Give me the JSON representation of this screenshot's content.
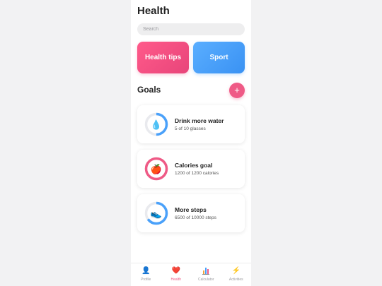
{
  "page": {
    "title": "Health"
  },
  "search": {
    "placeholder": "Search"
  },
  "tiles": [
    {
      "label": "Health tips",
      "color": "#ef5a86"
    },
    {
      "label": "Sport",
      "color": "#4aa1fa"
    }
  ],
  "goals": {
    "heading": "Goals",
    "add_label": "+",
    "items": [
      {
        "title": "Drink more water",
        "subtitle": "5 of 10 glasses",
        "icon": "water-drop-icon",
        "progress": 0.5,
        "color": "#4aa1fa"
      },
      {
        "title": "Calories goal",
        "subtitle": "1200 of 1200 calories",
        "icon": "apple-icon",
        "progress": 1.0,
        "color": "#ef5a86"
      },
      {
        "title": "More steps",
        "subtitle": "6500 of 10000 steps",
        "icon": "sneaker-icon",
        "progress": 0.65,
        "color": "#4aa1fa"
      }
    ]
  },
  "tabbar": {
    "active": "Health",
    "tabs": [
      {
        "label": "Profile",
        "icon": "user-icon"
      },
      {
        "label": "Health",
        "icon": "heart-icon"
      },
      {
        "label": "Calculator",
        "icon": "chart-icon"
      },
      {
        "label": "Activities",
        "icon": "lightning-icon"
      }
    ]
  }
}
